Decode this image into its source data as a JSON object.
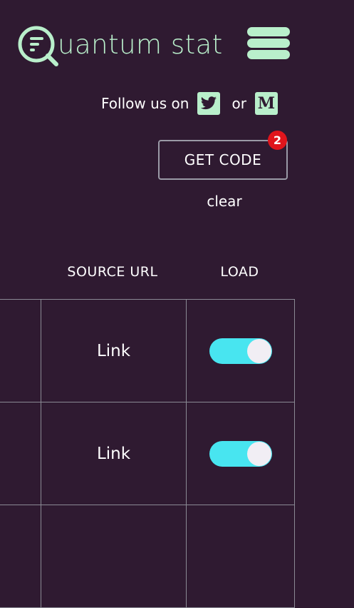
{
  "header": {
    "logo_text": "uantum stat",
    "logo_letter": "Q",
    "menu_icon": "hamburger-menu-icon"
  },
  "social": {
    "follow_label": "Follow us on",
    "or_label": "or",
    "twitter_icon": "twitter-icon",
    "medium_icon": "medium-icon",
    "medium_letter": "M"
  },
  "actions": {
    "get_code_label": "GET CODE",
    "badge_count": "2",
    "clear_label": "clear"
  },
  "table": {
    "columns": [
      "SOURCE URL",
      "LOAD"
    ],
    "rows": [
      {
        "source": "Link",
        "load": true
      },
      {
        "source": "Link",
        "load": true
      },
      {
        "source": "",
        "load": null
      }
    ]
  },
  "colors": {
    "background": "#2f1a31",
    "accent_mint": "#b9efcb",
    "toggle_on": "#48e5f0",
    "badge_red": "#e0151c"
  }
}
